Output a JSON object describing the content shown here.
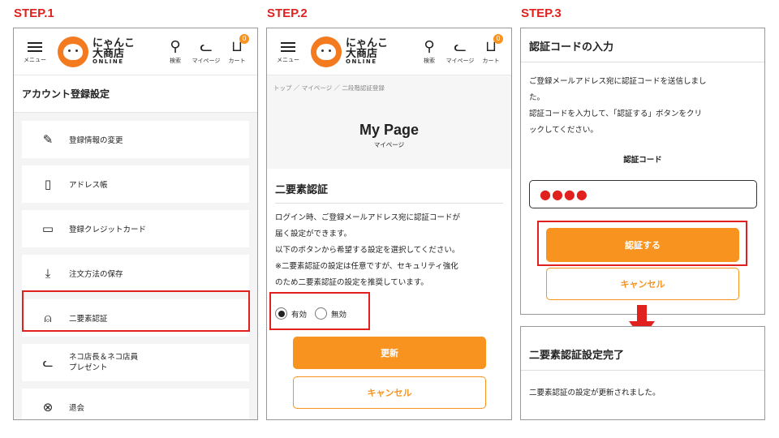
{
  "steps": [
    "STEP.1",
    "STEP.2",
    "STEP.3"
  ],
  "header": {
    "menu_label": "メニュー",
    "logo_line1": "にゃんこ",
    "logo_line2": "大商店",
    "logo_line3": "ONLINE",
    "search_label": "検索",
    "mypage_label": "マイページ",
    "cart_label": "カート",
    "cart_count": "0"
  },
  "step1": {
    "title": "アカウント登録設定",
    "items": [
      {
        "label": "登録情報の変更",
        "icon": "pencil-icon",
        "glyph": "✎"
      },
      {
        "label": "アドレス帳",
        "icon": "address-book-icon",
        "glyph": "▯"
      },
      {
        "label": "登録クレジットカード",
        "icon": "credit-card-icon",
        "glyph": "▭"
      },
      {
        "label": "注文方法の保存",
        "icon": "download-icon",
        "glyph": "⤓"
      },
      {
        "label": "二要素認証",
        "icon": "lock-icon",
        "glyph": "🔓"
      },
      {
        "label": "ネコ店長＆ネコ店員\nプレゼント",
        "icon": "cat-icon",
        "glyph": "ᓚ"
      },
      {
        "label": "退会",
        "icon": "close-circle-icon",
        "glyph": "⊗"
      }
    ]
  },
  "step2": {
    "breadcrumb": "トップ ／ マイページ ／ 二段階認証登録",
    "page_title": "My Page",
    "page_subtitle": "マイページ",
    "section_title": "二要素認証",
    "desc_lines": [
      "ログイン時、ご登録メールアドレス宛に認証コードが",
      "届く設定ができます。",
      "以下のボタンから希望する設定を選択してください。",
      "※二要素認証の設定は任意ですが、セキュリティ強化",
      "のため二要素認証の設定を推奨しています。"
    ],
    "radio_on": "有効",
    "radio_off": "無効",
    "update_button": "更新",
    "cancel_button": "キャンセル"
  },
  "step3": {
    "title": "認証コードの入力",
    "desc_lines": [
      "ご登録メールアドレス宛に認証コードを送信しまし",
      "た。",
      "認証コードを入力して、「認証する」ボタンをクリ",
      "ックしてください。"
    ],
    "code_label": "認証コード",
    "code_value": "●●●●",
    "verify_button": "認証する",
    "cancel_button": "キャンセル",
    "done_title": "二要素認証設定完了",
    "done_message": "二要素認証の設定が更新されました。"
  },
  "colors": {
    "accent": "#f7931e",
    "highlight": "#e0211d"
  }
}
